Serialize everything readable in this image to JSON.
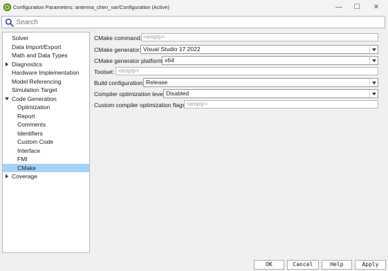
{
  "window": {
    "title": "Configuration Parameters: antenna_chen_var/Configuration (Active)",
    "minimize_glyph": "—",
    "maximize_glyph": "☐",
    "close_glyph": "✕",
    "app_icon": "gear-icon"
  },
  "search": {
    "placeholder": "Search",
    "icon": "search-icon"
  },
  "sidebar": {
    "items": [
      {
        "label": "Solver"
      },
      {
        "label": "Data Import/Export"
      },
      {
        "label": "Math and Data Types"
      },
      {
        "label": "Diagnostics",
        "expander": "collapsed"
      },
      {
        "label": "Hardware Implementation"
      },
      {
        "label": "Model Referencing"
      },
      {
        "label": "Simulation Target"
      },
      {
        "label": "Code Generation",
        "expander": "expanded"
      },
      {
        "label": "Optimization"
      },
      {
        "label": "Report"
      },
      {
        "label": "Comments"
      },
      {
        "label": "Identifiers"
      },
      {
        "label": "Custom Code"
      },
      {
        "label": "Interface"
      },
      {
        "label": "FMI"
      },
      {
        "label": "CMake",
        "selected": true
      },
      {
        "label": "Coverage",
        "expander": "collapsed"
      }
    ]
  },
  "main": {
    "cmake_command": {
      "label": "CMake command:",
      "placeholder": "<empty>"
    },
    "cmake_generator": {
      "label": "CMake generator:",
      "value": "Visual Studio 17 2022"
    },
    "cmake_generator_platform": {
      "label": "CMake generator platform:",
      "value": "x64"
    },
    "toolset": {
      "label": "Toolset:",
      "placeholder": "<empty>"
    },
    "build_configuration": {
      "label": "Build configuration:",
      "value": "Release"
    },
    "compiler_optimization_level": {
      "label": "Compiler optimization level:",
      "value": "Disabled"
    },
    "custom_optimization_flags": {
      "label": "Custom compiler optimization flags:",
      "placeholder": "<empty>"
    }
  },
  "footer": {
    "ok_label": "OK",
    "cancel_label": "Cancel",
    "help_label": "Help",
    "apply_label": "Apply"
  },
  "colors": {
    "selected_row": "#a6d2f5",
    "window_bg": "#f0f0f0",
    "field_border": "#b7b7b7"
  }
}
